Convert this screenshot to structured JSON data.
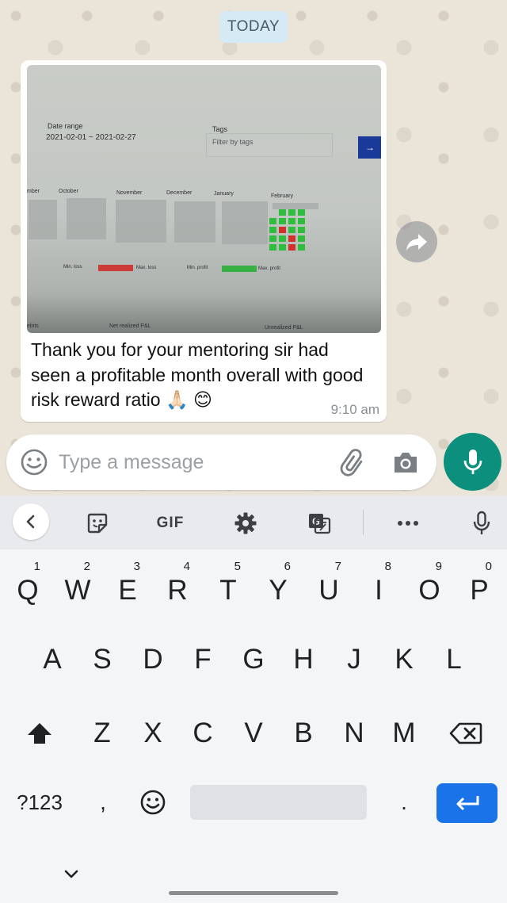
{
  "chat": {
    "date_chip": "TODAY",
    "message": {
      "text": "Thank you for your mentoring sir had seen a profitable month overall with good risk reward ratio 🙏🏻 😊",
      "time": "9:10 am",
      "photo": {
        "date_range_label": "Date range",
        "date_range_value": "2021-02-01 ~ 2021-02-27",
        "tags_label": "Tags",
        "tags_placeholder": "Filter by tags",
        "go_arrow": "→",
        "months": [
          "mber",
          "October",
          "November",
          "December",
          "January",
          "February"
        ],
        "legend": [
          "Min. loss",
          "Max. loss",
          "Min. profit",
          "Max. profit"
        ],
        "bottom_labels": [
          "ebits",
          "Net realized P&L",
          "Unrealized P&L"
        ]
      }
    }
  },
  "input": {
    "placeholder": "Type a message"
  },
  "keyboard": {
    "toolbar": {
      "gif": "GIF"
    },
    "row1": [
      "Q",
      "W",
      "E",
      "R",
      "T",
      "Y",
      "U",
      "I",
      "O",
      "P"
    ],
    "row1_hints": [
      "1",
      "2",
      "3",
      "4",
      "5",
      "6",
      "7",
      "8",
      "9",
      "0"
    ],
    "row2": [
      "A",
      "S",
      "D",
      "F",
      "G",
      "H",
      "J",
      "K",
      "L"
    ],
    "row3": [
      "Z",
      "X",
      "C",
      "V",
      "B",
      "N",
      "M"
    ],
    "symbols_key": "?123",
    "comma": ",",
    "period": "."
  },
  "icons": {
    "emoji": "emoji-icon",
    "attach": "paperclip-icon",
    "camera": "camera-icon",
    "mic": "microphone-icon",
    "forward": "forward-icon",
    "shift": "shift-icon",
    "backspace": "backspace-icon",
    "enter": "enter-icon"
  },
  "colors": {
    "accent": "#0d8f7d",
    "enter_key": "#1a73e8",
    "date_chip": "#d6eaf5"
  }
}
